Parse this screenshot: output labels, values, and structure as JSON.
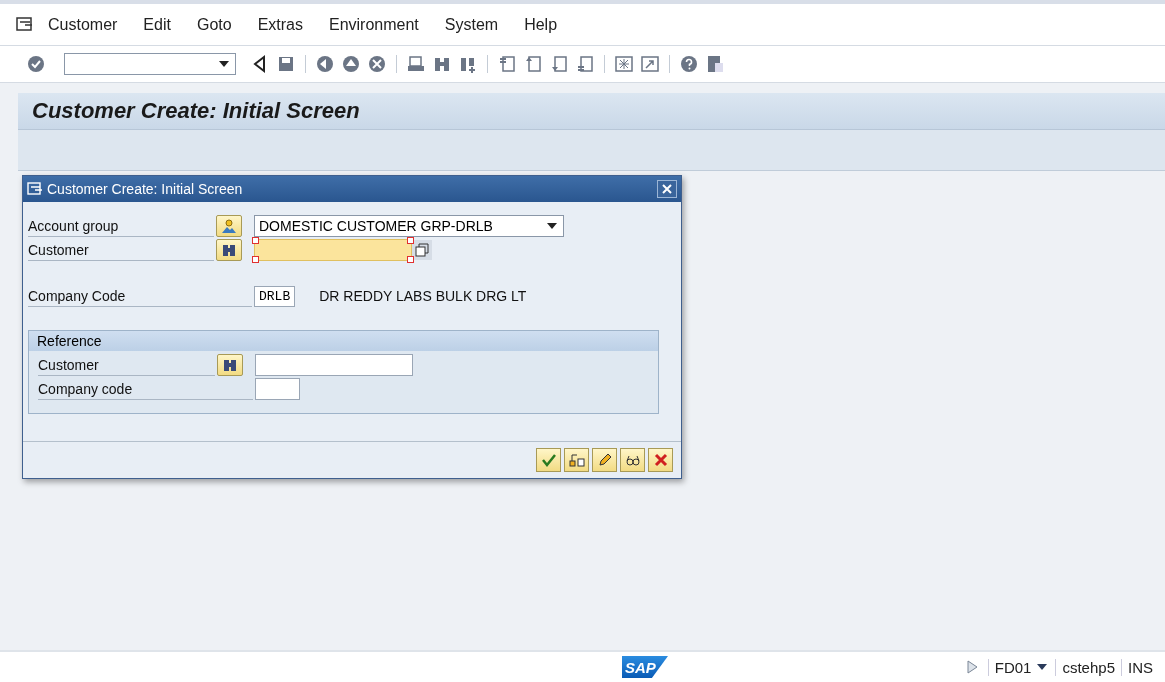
{
  "menu": [
    "Customer",
    "Edit",
    "Goto",
    "Extras",
    "Environment",
    "System",
    "Help"
  ],
  "title": "Customer Create: Initial Screen",
  "dialog": {
    "title": "Customer Create: Initial Screen",
    "account_group": {
      "label": "Account group",
      "value": "DOMESTIC CUSTOMER GRP-DRLB"
    },
    "customer": {
      "label": "Customer",
      "focused": true
    },
    "company_code": {
      "label": "Company Code",
      "value": "DRLB",
      "description": "DR REDDY LABS BULK DRG LT"
    },
    "reference": {
      "title": "Reference",
      "customer_label": "Customer",
      "company_code_label": "Company code"
    }
  },
  "status_bar": {
    "logo": "SAP",
    "transaction": "FD01",
    "server": "cstehp5",
    "mode": "INS"
  }
}
